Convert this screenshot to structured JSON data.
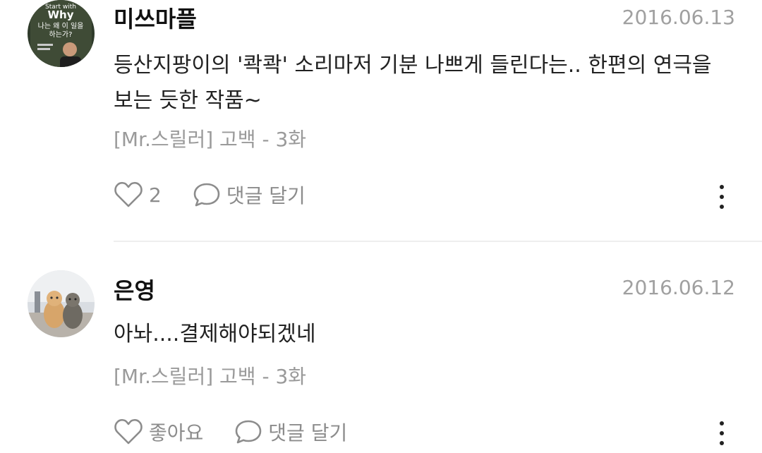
{
  "comments": [
    {
      "author": "미쓰마플",
      "date": "2016.06.13",
      "text": "등산지팡이의 '콱콱' 소리마저 기분 나쁘게 들린다는.. 한편의 연극을 보는 듯한 작품~",
      "episode": "[Mr.스릴러] 고백 - 3화",
      "like_label": "2",
      "reply_label": "댓글 달기",
      "avatar_text": {
        "line1": "Start with",
        "line2": "Why",
        "line3": "나는 왜 이 일을",
        "line4": "하는가?"
      }
    },
    {
      "author": "은영",
      "date": "2016.06.12",
      "text": "아놔....결제해야되겠네",
      "episode": "[Mr.스릴러] 고백 - 3화",
      "like_label": "좋아요",
      "reply_label": "댓글 달기"
    }
  ],
  "icons": {
    "like": "heart-outline-icon",
    "reply": "speech-bubble-icon",
    "more": "more-vertical-icon"
  },
  "colors": {
    "meta_gray": "#9a9a9a",
    "action_gray": "#8c8c8c",
    "divider": "#eeeeee"
  }
}
